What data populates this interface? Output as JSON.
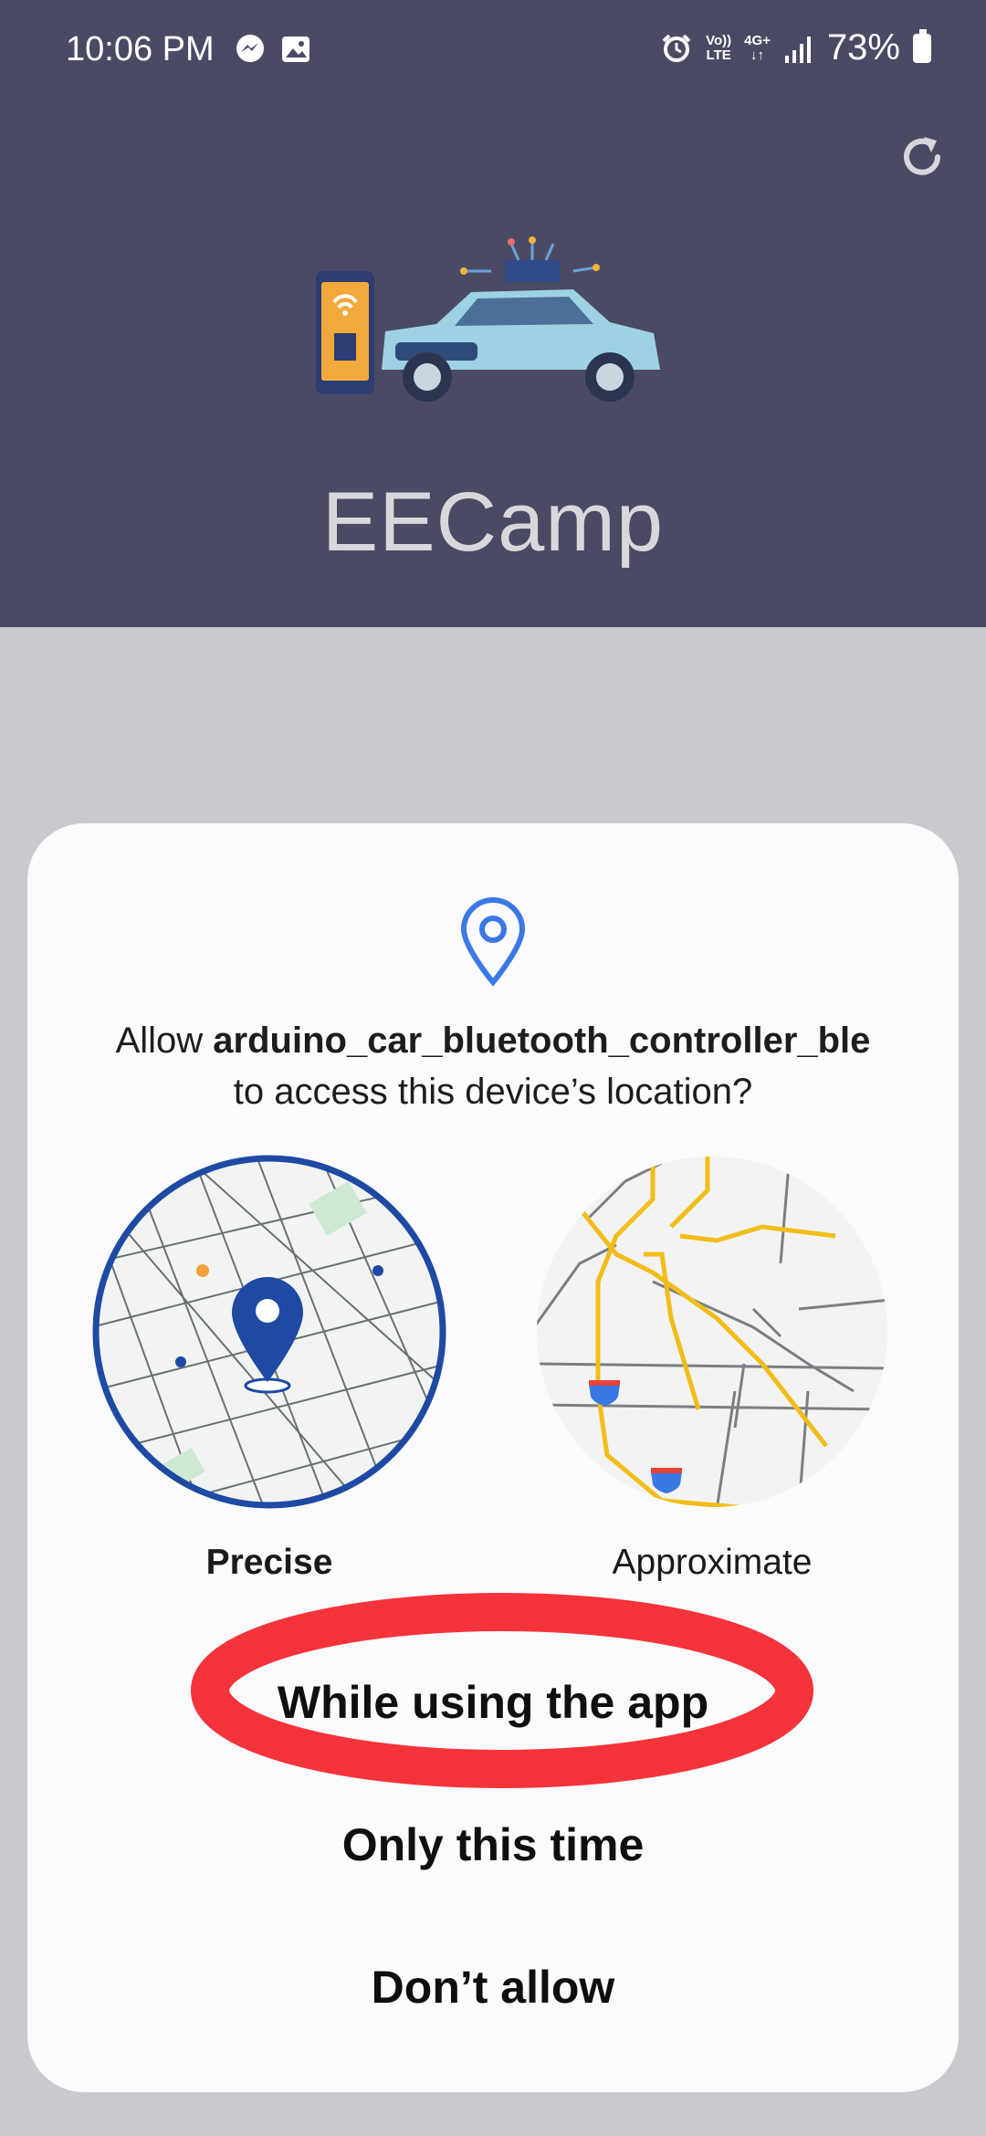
{
  "status_bar": {
    "time": "10:06 PM",
    "left_icons": [
      "messenger-icon",
      "gallery-icon"
    ],
    "volte_top": "Vo))",
    "volte_bottom": "LTE",
    "network_top": "4G+",
    "network_bottom": "↓↑",
    "battery": "73%"
  },
  "app": {
    "title": "EECamp",
    "refresh_icon": "refresh-icon",
    "header_color": "#4b4a64"
  },
  "dialog": {
    "prompt_prefix": "Allow ",
    "app_name": "arduino_car_bluetooth_controller_ble",
    "prompt_suffix": "to access this device’s location?",
    "options": {
      "precise": "Precise",
      "approximate": "Approximate"
    },
    "selected_option": "Precise",
    "buttons": {
      "while_using": "While using the app",
      "only_this_time": "Only this time",
      "deny": "Don’t allow"
    },
    "annotation_color": "#f5333a"
  }
}
